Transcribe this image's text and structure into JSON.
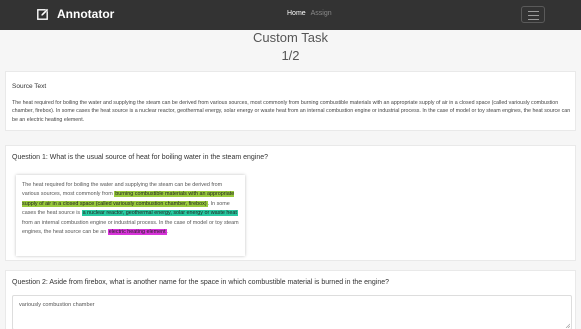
{
  "navbar": {
    "brand": "Annotator",
    "brand_icon": "edit-square-icon",
    "home_label": "Home",
    "assign_label": "Assign",
    "menu_icon": "hamburger-icon"
  },
  "page": {
    "title": "Custom Task",
    "progress": "1/2"
  },
  "source": {
    "heading": "Source Text",
    "text": "The heat required for boiling the water and supplying the steam can be derived from various sources, most commonly from burning combustible materials with an appropriate supply of air in a closed space (called variously combustion chamber, firebox). In some cases the heat source is a nuclear reactor, geothermal energy, solar energy or waste heat from an internal combustion engine or industrial process. In the case of model or toy steam engines, the heat source can be an electric heating element."
  },
  "question1": {
    "heading": "Question 1: What is the usual source of heat for boiling water in the steam engine?",
    "seg1": "The heat required for boiling the water and supplying the steam can be derived from various sources, most commonly from ",
    "hl1": "burning combustible materials with an appropriate supply of air in a closed space (called variously combustion chamber, firebox)",
    "seg2": ". In some cases the heat source is ",
    "hl2": "a nuclear reactor, geothermal energy, solar energy or waste heat",
    "seg3": " from an internal combustion engine or industrial process. In the case of model or toy steam engines, the heat source can be an ",
    "hl3": "electric heating element",
    "seg4": ".",
    "colors": {
      "highlight1": "#98c93c",
      "highlight2": "#27c8a0",
      "highlight3": "#d733d9"
    }
  },
  "question2": {
    "heading": "Question 2: Aside from firebox, what is another name for the space in which combustible material is burned in the engine?",
    "answer": "variously combustion chamber"
  }
}
